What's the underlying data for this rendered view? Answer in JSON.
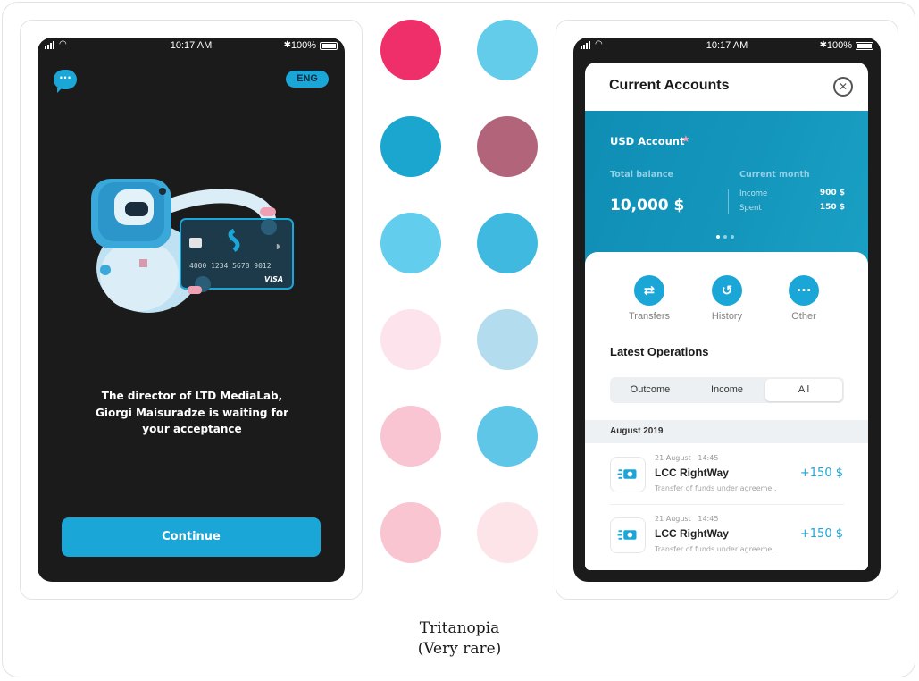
{
  "statusbar": {
    "time": "10:17 AM",
    "battery": "100%"
  },
  "left_screen": {
    "chat_icon": "chat-bubble-icon",
    "language_button": "ENG",
    "card_number": "4000 1234 5678 9012",
    "card_brand": "VISA",
    "message": "The director of LTD MediaLab, Giorgi Maisuradze is waiting for your acceptance",
    "continue_label": "Continue"
  },
  "swatches": {
    "colors": [
      "#ef2f69",
      "#63cceb",
      "#1ba6cf",
      "#b2647a",
      "#62cdec",
      "#3fb9e0",
      "#fde3ec",
      "#b4dcef",
      "#f9c5d3",
      "#5fc6e8",
      "#f8c5d1",
      "#fde4e8"
    ]
  },
  "right_screen": {
    "title": "Current Accounts",
    "account": {
      "name": "USD Account",
      "star": "★",
      "total_balance_label": "Total balance",
      "total_balance_value": "10,000 $",
      "current_month_label": "Current month",
      "income_label": "Income",
      "income_value": "900 $",
      "spent_label": "Spent",
      "spent_value": "150 $"
    },
    "actions": [
      {
        "label": "Transfers",
        "icon": "transfer-icon"
      },
      {
        "label": "History",
        "icon": "history-icon"
      },
      {
        "label": "Other",
        "icon": "more-icon"
      }
    ],
    "latest_operations_title": "Latest Operations",
    "segments": [
      "Outcome",
      "Income",
      "All"
    ],
    "selected_segment": "All",
    "month_header": "August 2019",
    "operations": [
      {
        "date": "21 August",
        "time": "14:45",
        "name": "LCC RightWay",
        "description": "Transfer of funds under agreeme..",
        "amount": "+150 $"
      },
      {
        "date": "21 August",
        "time": "14:45",
        "name": "LCC RightWay",
        "description": "Transfer of funds under agreeme..",
        "amount": "+150 $"
      }
    ]
  },
  "caption": {
    "line1": "Tritanopia",
    "line2": "(Very rare)"
  }
}
